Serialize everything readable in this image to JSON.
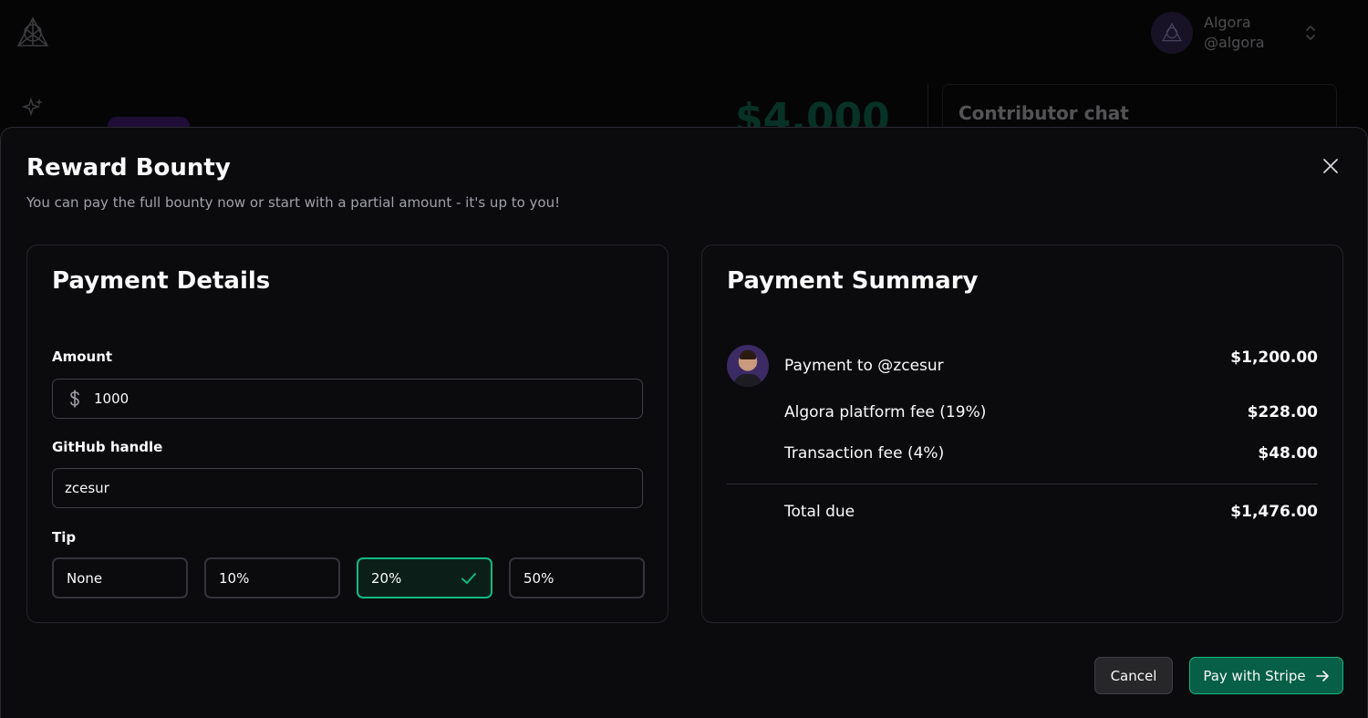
{
  "background": {
    "user_name": "Algora",
    "user_handle": "@algora",
    "bounty_amount": "$4,000",
    "chat_title": "Contributor chat"
  },
  "modal": {
    "title": "Reward Bounty",
    "subtitle": "You can pay the full bounty now or start with a partial amount - it's up to you!"
  },
  "payment_details": {
    "title": "Payment Details",
    "amount_label": "Amount",
    "amount_value": "1000",
    "github_label": "GitHub handle",
    "github_value": "zcesur",
    "tip_label": "Tip",
    "tip_options": [
      "None",
      "10%",
      "20%",
      "50%"
    ],
    "tip_selected": "20%"
  },
  "payment_summary": {
    "title": "Payment Summary",
    "recipient_label": "Payment to @zcesur",
    "recipient_amount": "$1,200.00",
    "platform_fee_label": "Algora platform fee (19%)",
    "platform_fee_amount": "$228.00",
    "transaction_fee_label": "Transaction fee (4%)",
    "transaction_fee_amount": "$48.00",
    "total_label": "Total due",
    "total_amount": "$1,476.00"
  },
  "actions": {
    "cancel_label": "Cancel",
    "pay_label": "Pay with Stripe"
  },
  "colors": {
    "accent": "#10b981",
    "pay_button": "#065f46",
    "modal_bg": "#0b0b0e"
  }
}
